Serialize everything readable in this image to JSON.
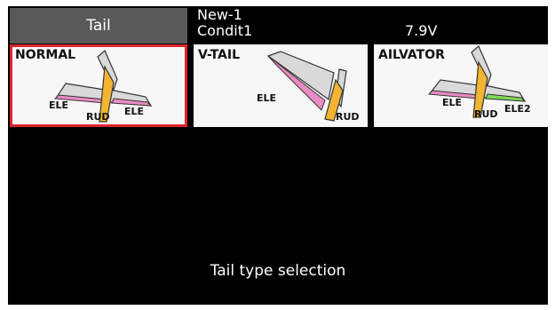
{
  "header": {
    "title": "Tail",
    "model_name": "New-1",
    "condition": "Condit1",
    "voltage": "7.9V"
  },
  "tail_options": [
    {
      "label": "NORMAL",
      "selected": true,
      "surfaces": {
        "left": "ELE",
        "center": "RUD",
        "right": "ELE"
      }
    },
    {
      "label": "V-TAIL",
      "selected": false,
      "surfaces": {
        "left": "ELE",
        "right": "RUD"
      }
    },
    {
      "label": "AILVATOR",
      "selected": false,
      "surfaces": {
        "left": "ELE",
        "center": "RUD",
        "right": "ELE2"
      }
    }
  ],
  "footer": {
    "hint": "Tail type selection"
  },
  "colors": {
    "selected_border": "#e0252b",
    "rudder": "#f2b431",
    "elevator": "#e98bc6",
    "elevator2": "#7ed957",
    "title_bg": "#595959"
  }
}
